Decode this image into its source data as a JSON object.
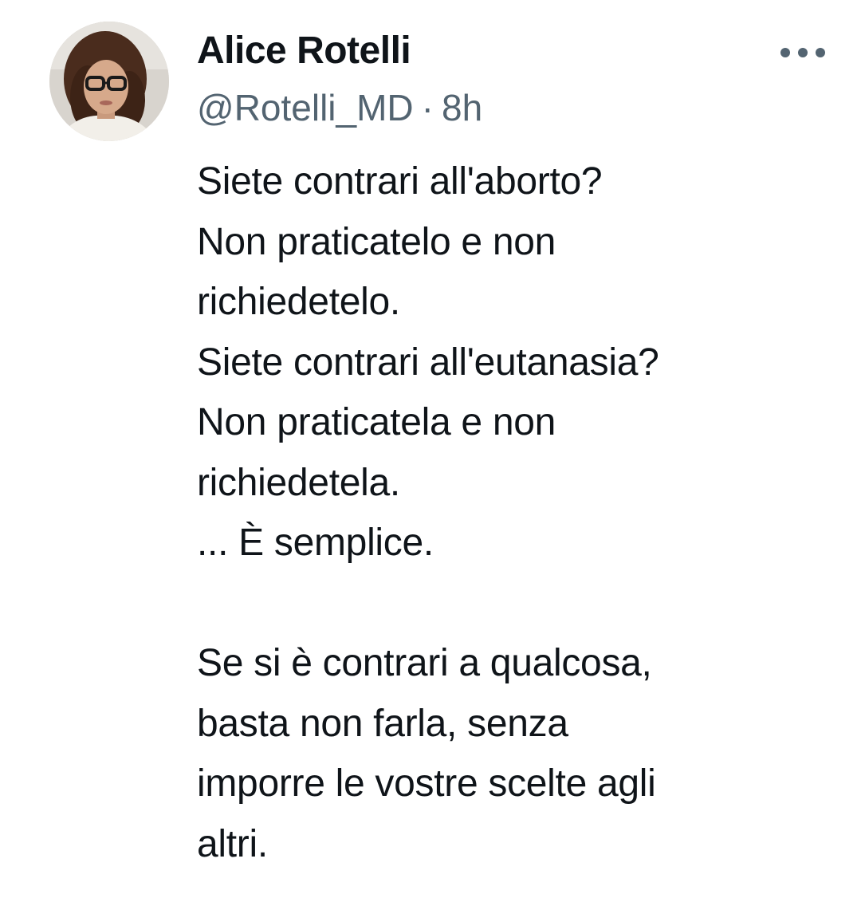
{
  "tweet": {
    "author": {
      "display_name": "Alice Rotelli",
      "handle": "@Rotelli_MD",
      "avatar_icon": "profile-photo"
    },
    "timestamp": "8h",
    "separator": "·",
    "more_icon": "ellipsis-icon",
    "text_paragraphs": [
      [
        "Siete contrari all'aborto?",
        "Non praticatelo e non",
        "richiedetelo.",
        "Siete contrari all'eutanasia?",
        "Non praticatela e non",
        "richiedetela.",
        "... È semplice."
      ],
      [
        "Se si è contrari a qualcosa,",
        "basta non farla, senza",
        "imporre le vostre scelte agli",
        "altri."
      ]
    ]
  },
  "colors": {
    "text_primary": "#0f1419",
    "text_secondary": "#536471",
    "background": "#ffffff"
  }
}
